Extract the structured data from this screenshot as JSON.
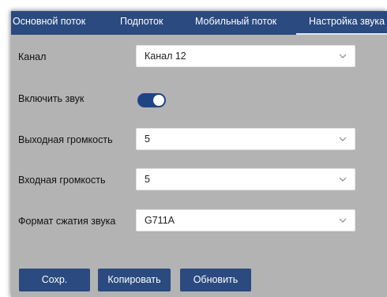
{
  "tabs": [
    {
      "label": "Основной поток",
      "active": false
    },
    {
      "label": "Подпоток",
      "active": false
    },
    {
      "label": "Мобильный поток",
      "active": false
    },
    {
      "label": "Настройка звука",
      "active": true
    }
  ],
  "form": {
    "channel": {
      "label": "Канал",
      "value": "Канал 12"
    },
    "enable_sound": {
      "label": "Включить звук",
      "checked": true
    },
    "output_volume": {
      "label": "Выходная громкость",
      "value": "5"
    },
    "input_volume": {
      "label": "Входная громкость",
      "value": "5"
    },
    "compression": {
      "label": "Формат сжатия звука",
      "value": "G711A"
    }
  },
  "buttons": {
    "save": "Сохр.",
    "copy": "Копировать",
    "refresh": "Обновить"
  },
  "colors": {
    "tab_bar": "#2a4a80",
    "panel": "#b3b3b3",
    "toggle_on": "#1f4485",
    "button": "#2a4a80"
  },
  "icons": {
    "select_arrow": "chevron-down-icon"
  }
}
